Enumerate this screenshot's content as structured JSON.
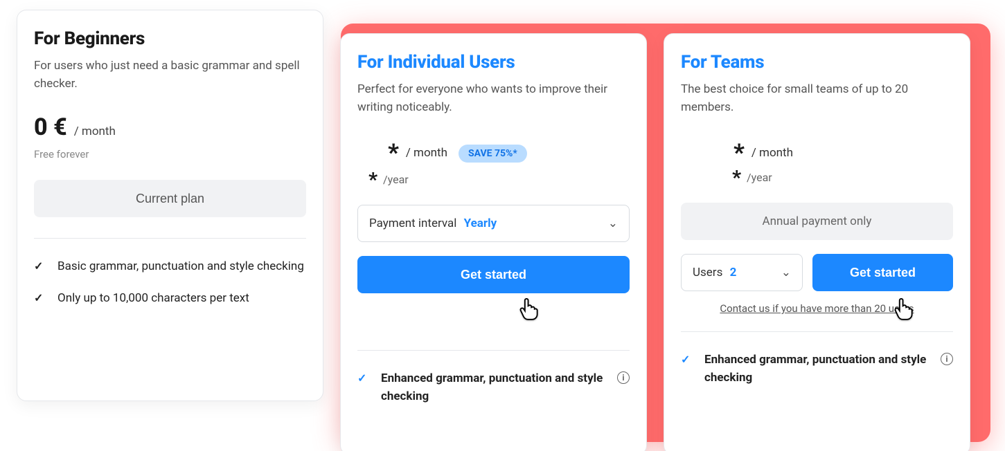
{
  "plans": {
    "beginners": {
      "title": "For Beginners",
      "subtitle": "For users who just need a basic grammar and spell checker.",
      "price": "0 €",
      "price_unit": "/ month",
      "note": "Free forever",
      "cta": "Current plan",
      "features": [
        "Basic grammar, punctuation and style checking",
        "Only up to 10,000 characters per text"
      ]
    },
    "individual": {
      "title": "For Individual Users",
      "subtitle": "Perfect for everyone who wants to improve their writing noticeably.",
      "price_monthly_prefix": "*",
      "price_monthly_unit": "/ month",
      "save_badge": "SAVE 75%*",
      "price_yearly_prefix": "*",
      "price_yearly_unit": "/year",
      "interval_label": "Payment interval",
      "interval_value": "Yearly",
      "cta": "Get started",
      "feature": "Enhanced grammar, punctuation and style checking"
    },
    "teams": {
      "title": "For Teams",
      "subtitle": "The best choice for small teams of up to 20 members.",
      "price_monthly_prefix": "*",
      "price_monthly_unit": "/ month",
      "price_yearly_prefix": "*",
      "price_yearly_unit": "/year",
      "annual_note": "Annual payment only",
      "users_label": "Users",
      "users_value": "2",
      "cta": "Get started",
      "contact": "Contact us if you have more than 20 users",
      "feature": "Enhanced grammar, punctuation and style checking"
    }
  }
}
